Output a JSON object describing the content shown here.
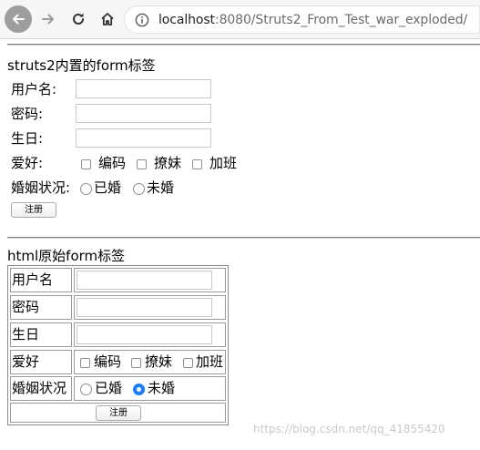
{
  "browser": {
    "url_host": "localhost",
    "url_rest": ":8080/Struts2_From_Test_war_exploded/",
    "icons": [
      "back-arrow-icon",
      "forward-arrow-icon",
      "reload-icon",
      "home-icon",
      "info-icon"
    ]
  },
  "struts_form": {
    "caption": "struts2内置的form标签",
    "username_label": "用户名:",
    "password_label": "密码:",
    "birthday_label": "生日:",
    "hobby_label": "爱好:",
    "hobbies": [
      "编码",
      "撩妹",
      "加班"
    ],
    "marital_label": "婚姻状况:",
    "marital_options": [
      "已婚",
      "未婚"
    ],
    "submit_label": "注册"
  },
  "html_form": {
    "caption": "html原始form标签",
    "username_label": "用户名",
    "password_label": "密码",
    "birthday_label": "生日",
    "hobby_label": "爱好",
    "hobbies": [
      "编码",
      "撩妹",
      "加班"
    ],
    "marital_label": "婚姻状况",
    "marital_options": [
      "已婚",
      "未婚"
    ],
    "marital_selected": "未婚",
    "submit_label": "注册"
  },
  "watermark": "https://blog.csdn.net/qq_41855420",
  "colors": {
    "toolbar_bg": "#f6f6f6",
    "radio_accent": "#1a7ff5",
    "watermark": "#c9c9c9"
  }
}
